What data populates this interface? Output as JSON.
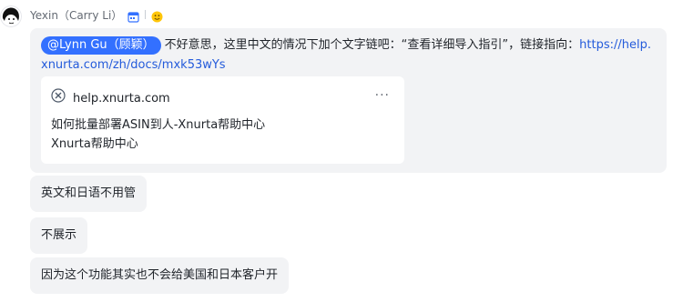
{
  "message": {
    "sender": "Yexin（Carry Li）",
    "header_icons": [
      "calendar-icon",
      "emoji-icon"
    ],
    "mention": "@Lynn Gu（顾颖）",
    "text": "不好意思，这里中文的情况下加个文字链吧：“查看详细导入指引”，链接指向：",
    "link": "https://help.xnurta.com/zh/docs/mxk53wYs"
  },
  "link_card": {
    "domain": "help.xnurta.com",
    "more": "···",
    "title": "如何批量部署ASIN到人-Xnurta帮助中心",
    "subtitle": "Xnurta帮助中心"
  },
  "followups": [
    "英文和日语不用管",
    "不展示",
    "因为这个功能其实也不会给美国和日本客户开"
  ],
  "colors": {
    "mention_bg": "#3370ff",
    "link": "#245bdb",
    "bubble_bg": "#f2f3f5"
  }
}
